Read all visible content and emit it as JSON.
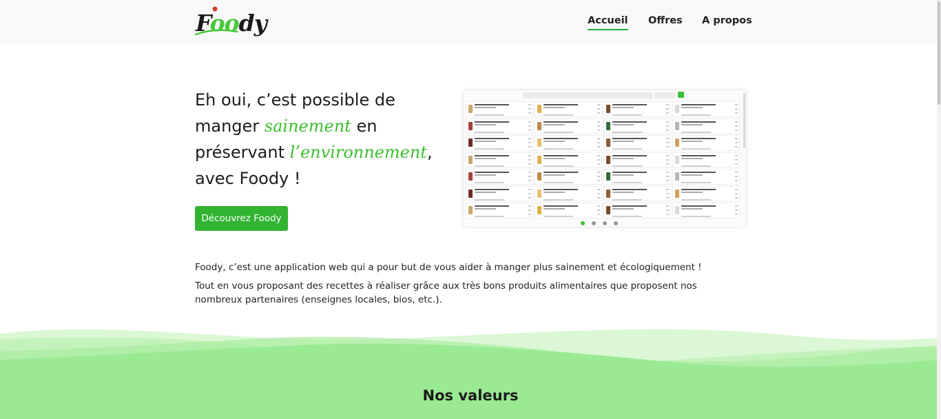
{
  "nav": {
    "logo_text_1": "F",
    "logo_text_green": "oo",
    "logo_text_2": "dy",
    "links": [
      "Accueil",
      "Offres",
      "A propos"
    ],
    "active": "Accueil"
  },
  "hero": {
    "title_part1": "Eh oui, c’est possible de manger ",
    "title_highlight1": "sainement",
    "title_part2": " en préservant ",
    "title_highlight2": "l’environnement",
    "title_part3": ", avec Foody !",
    "cta_label": "Découvrez Foody"
  },
  "intro": {
    "paragraph1": "Foody, c’est une application web qui a pour but de vous aider à manger plus sainement et écologiquement !",
    "paragraph2": "Tout en vous proposant des recettes à réaliser grâce aux très bons produits alimentaires que proposent nos nombreux partenaires (enseignes locales, bios, etc.)."
  },
  "section_title": "Nos valeurs",
  "colors": {
    "accent": "#3cbe2f",
    "button": "#32b332",
    "wave_light": "#dcf7d6",
    "wave_dark": "#9aea94"
  }
}
